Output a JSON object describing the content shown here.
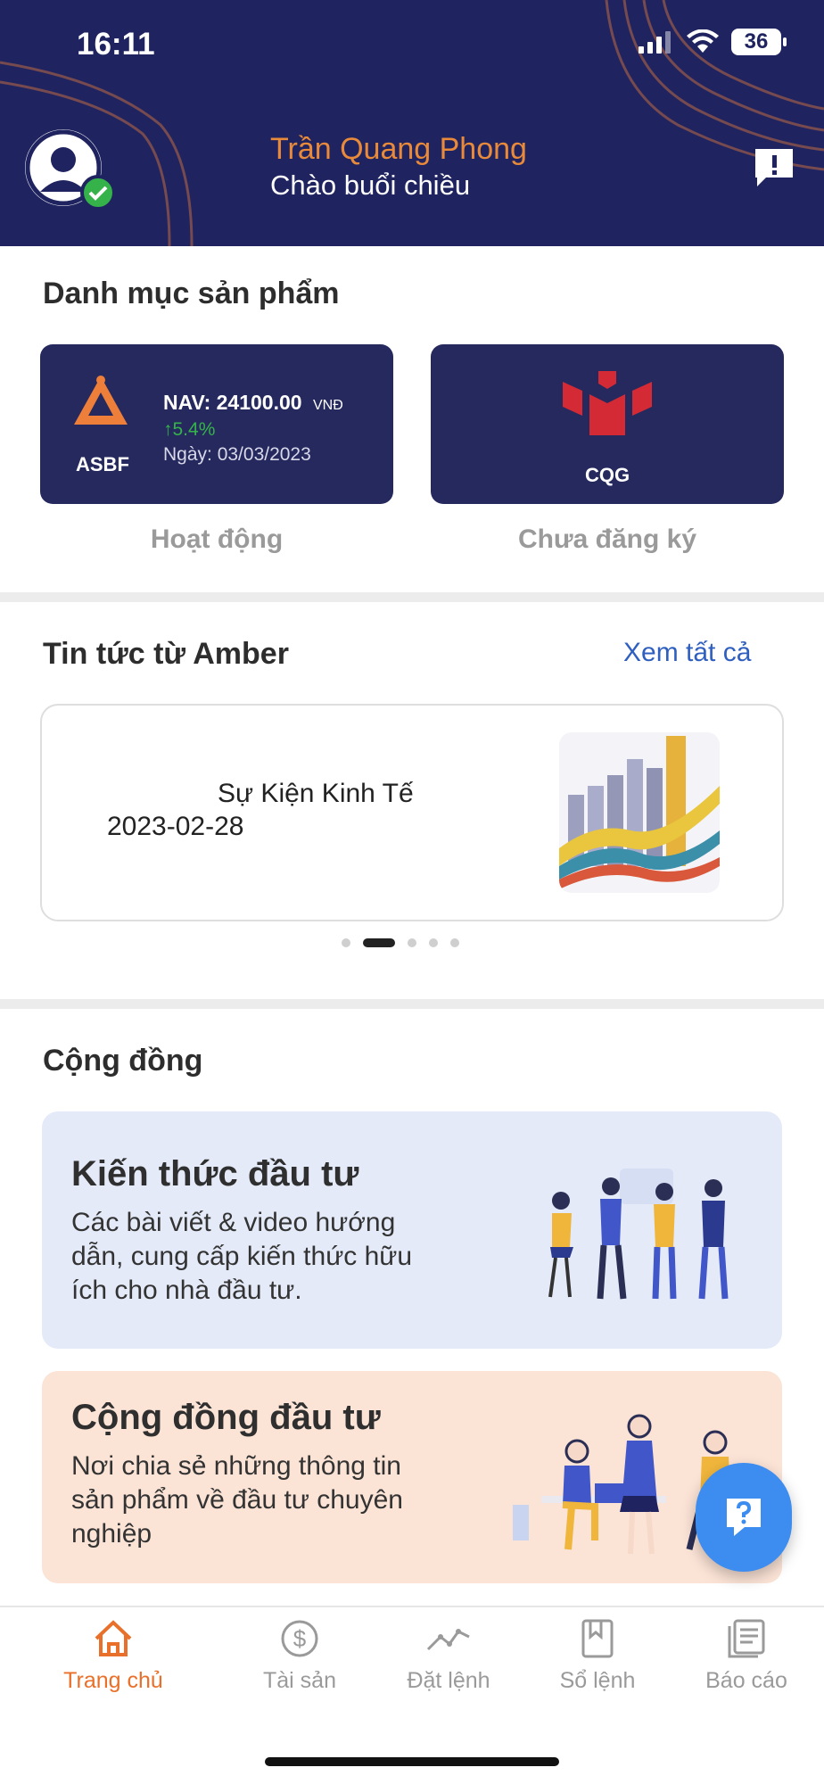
{
  "status_bar": {
    "time": "16:11",
    "battery": "36"
  },
  "header": {
    "user_name": "Trần Quang Phong",
    "greeting": "Chào buổi chiều"
  },
  "products": {
    "title": "Danh mục sản phẩm",
    "cards": [
      {
        "logo_label": "ASBF",
        "nav_label": "NAV:",
        "nav_value": "24100.00",
        "currency": "VNĐ",
        "change": "5.4%",
        "date": "Ngày: 03/03/2023",
        "status": "Hoạt động"
      },
      {
        "logo_label": "CQG",
        "status": "Chưa đăng ký"
      }
    ]
  },
  "news": {
    "title": "Tin tức từ Amber",
    "see_all": "Xem tất cả",
    "item": {
      "headline": "Sự Kiện Kinh Tế",
      "date": "2023-02-28"
    },
    "pager": {
      "count": 5,
      "active_index": 1
    }
  },
  "community": {
    "title": "Cộng đồng",
    "cards": [
      {
        "title": "Kiến thức đầu tư",
        "description": "Các bài viết & video hướng dẫn, cung cấp kiến thức hữu ích cho nhà đầu tư.",
        "bg_color": "#e4eaf8"
      },
      {
        "title": "Cộng đồng đầu tư",
        "description": "Nơi chia sẻ những thông tin sản phẩm về đầu tư chuyên nghiệp",
        "bg_color": "#fbe3d6"
      }
    ]
  },
  "tabbar": {
    "tabs": [
      {
        "label": "Trang chủ",
        "icon": "home-icon",
        "active": true
      },
      {
        "label": "Tài sản",
        "icon": "dollar-icon",
        "active": false
      },
      {
        "label": "Đặt lệnh",
        "icon": "chart-line-icon",
        "active": false
      },
      {
        "label": "Sổ lệnh",
        "icon": "bookmark-book-icon",
        "active": false
      },
      {
        "label": "Báo cáo",
        "icon": "report-icon",
        "active": false
      }
    ]
  },
  "colors": {
    "header_bg": "#1f2460",
    "accent_orange": "#e8702a",
    "link_blue": "#2f5fbf",
    "card_navy": "#25295e",
    "positive_green": "#35b34a",
    "fab_blue": "#3d8cf0"
  }
}
